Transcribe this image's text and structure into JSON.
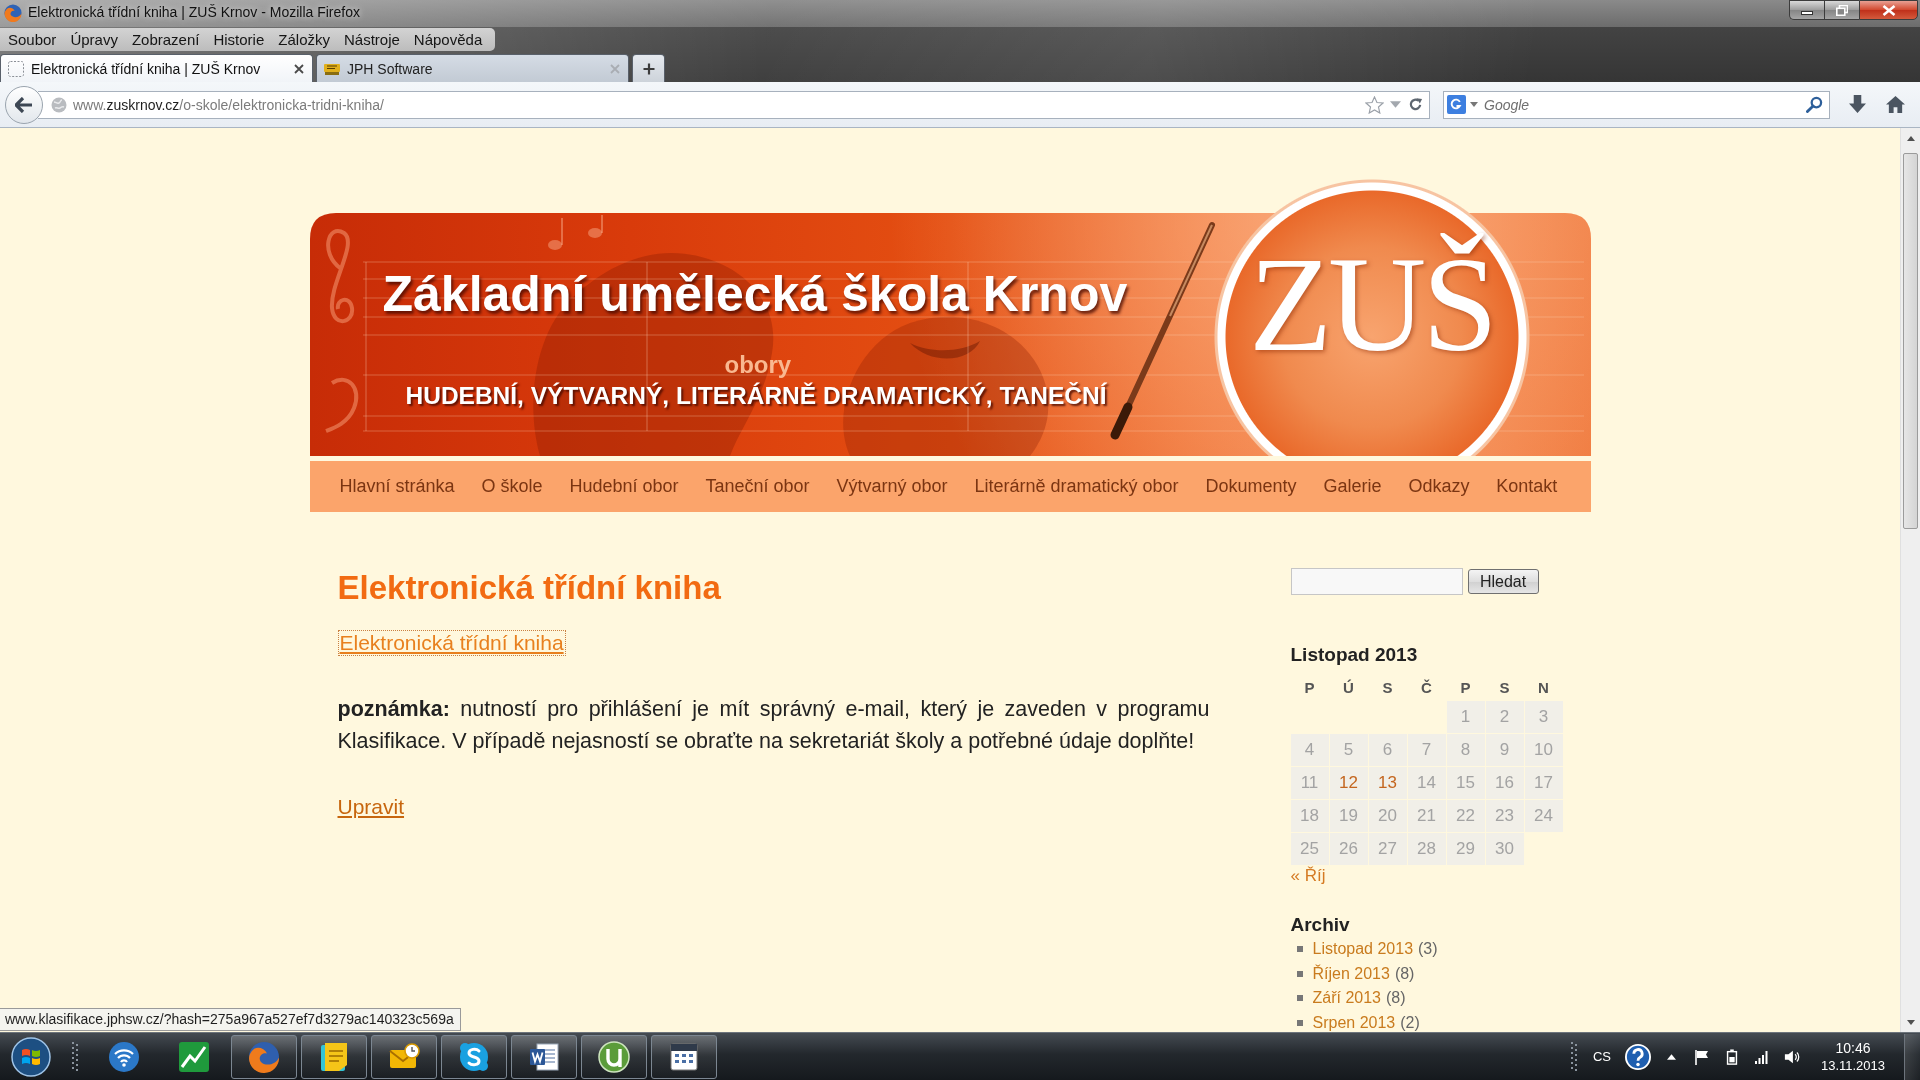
{
  "window": {
    "title": "Elektronická třídní kniha | ZUŠ Krnov - Mozilla Firefox"
  },
  "menu_bar": {
    "items": [
      "Soubor",
      "Úpravy",
      "Zobrazení",
      "Historie",
      "Záložky",
      "Nástroje",
      "Nápověda"
    ]
  },
  "tabs": [
    {
      "label": "Elektronická třídní kniha | ZUŠ Krnov",
      "selected": true,
      "kind": "blank"
    },
    {
      "label": "JPH Software",
      "selected": false,
      "kind": "logo"
    }
  ],
  "address_bar": {
    "url_parts": [
      {
        "text": "www.",
        "kind": "dim"
      },
      {
        "text": "zuskrnov.cz",
        "kind": "host"
      },
      {
        "text": "/o-skole/elektronicka-tridni-kniha/",
        "kind": "dim"
      }
    ]
  },
  "search_bar": {
    "placeholder": "Google"
  },
  "page": {
    "banner": {
      "title": "Základní umělecká škola Krnov",
      "label": "obory",
      "subtitle": "HUDEBNÍ, VÝTVARNÝ, LITERÁRNĚ DRAMATICKÝ, TANEČNÍ",
      "logo": "ZUŠ"
    },
    "nav": [
      "Hlavní stránka",
      "O škole",
      "Hudební obor",
      "Taneční obor",
      "Výtvarný obor",
      "Literárně dramatický obor",
      "Dokumenty",
      "Galerie",
      "Odkazy",
      "Kontakt"
    ],
    "article": {
      "heading": "Elektronická třídní kniha",
      "link": {
        "text": "Elektronická třídní kniha",
        "focused": true
      },
      "note": "**poznámka:** nutností pro přihlášení je mít správný e-mail, který je zaveden v programu Klasifikace. V případě nejasností se obraťte na sekretariát školy a potřebné údaje doplňte!",
      "edit_link": "Upravit"
    },
    "sidebar": {
      "search_button": "Hledat",
      "calendar": {
        "title": "Listopad 2013",
        "weekdays": [
          "P",
          "Ú",
          "S",
          "Č",
          "P",
          "S",
          "N"
        ],
        "weeks": [
          [
            {
              "kind": "blank"
            },
            {
              "kind": "blank"
            },
            {
              "kind": "blank"
            },
            {
              "kind": "blank"
            },
            {
              "kind": "day",
              "day": "1",
              "linked": false
            },
            {
              "kind": "day",
              "day": "2",
              "linked": false
            },
            {
              "kind": "day",
              "day": "3",
              "linked": false
            }
          ],
          [
            {
              "kind": "day",
              "day": "4",
              "linked": false
            },
            {
              "kind": "day",
              "day": "5",
              "linked": false
            },
            {
              "kind": "day",
              "day": "6",
              "linked": false
            },
            {
              "kind": "day",
              "day": "7",
              "linked": false
            },
            {
              "kind": "day",
              "day": "8",
              "linked": false
            },
            {
              "kind": "day",
              "day": "9",
              "linked": false
            },
            {
              "kind": "day",
              "day": "10",
              "linked": false
            }
          ],
          [
            {
              "kind": "day",
              "day": "11",
              "linked": false
            },
            {
              "kind": "day",
              "day": "12",
              "linked": true
            },
            {
              "kind": "day",
              "day": "13",
              "linked": true
            },
            {
              "kind": "day",
              "day": "14",
              "linked": false
            },
            {
              "kind": "day",
              "day": "15",
              "linked": false
            },
            {
              "kind": "day",
              "day": "16",
              "linked": false
            },
            {
              "kind": "day",
              "day": "17",
              "linked": false
            }
          ],
          [
            {
              "kind": "day",
              "day": "18",
              "linked": false
            },
            {
              "kind": "day",
              "day": "19",
              "linked": false
            },
            {
              "kind": "day",
              "day": "20",
              "linked": false
            },
            {
              "kind": "day",
              "day": "21",
              "linked": false
            },
            {
              "kind": "day",
              "day": "22",
              "linked": false
            },
            {
              "kind": "day",
              "day": "23",
              "linked": false
            },
            {
              "kind": "day",
              "day": "24",
              "linked": false
            }
          ],
          [
            {
              "kind": "day",
              "day": "25",
              "linked": false
            },
            {
              "kind": "day",
              "day": "26",
              "linked": false
            },
            {
              "kind": "day",
              "day": "27",
              "linked": false
            },
            {
              "kind": "day",
              "day": "28",
              "linked": false
            },
            {
              "kind": "day",
              "day": "29",
              "linked": false
            },
            {
              "kind": "day",
              "day": "30",
              "linked": false
            },
            {
              "kind": "blank"
            }
          ]
        ],
        "prev_month": "« Říj"
      },
      "archive": {
        "title": "Archiv",
        "items": [
          {
            "label": "Listopad 2013",
            "count": "(3)"
          },
          {
            "label": "Říjen 2013",
            "count": "(8)"
          },
          {
            "label": "Září 2013",
            "count": "(8)"
          },
          {
            "label": "Srpen 2013",
            "count": "(2)"
          }
        ]
      }
    }
  },
  "status_tooltip": "www.klasifikace.jphsw.cz/?hash=275a967a527ef7d3279ac140323c569a",
  "taskbar": {
    "apps": [
      {
        "kind": "network",
        "running": false
      },
      {
        "kind": "chart",
        "running": false
      },
      {
        "kind": "browser",
        "running": true
      },
      {
        "kind": "notes",
        "running": true
      },
      {
        "kind": "mail",
        "running": true
      },
      {
        "kind": "chat",
        "running": true
      },
      {
        "kind": "doc",
        "running": true
      },
      {
        "kind": "hook",
        "running": true
      },
      {
        "kind": "calendar",
        "running": true
      }
    ],
    "language": "CS",
    "time": "10:46",
    "date": "13.11.2013"
  }
}
